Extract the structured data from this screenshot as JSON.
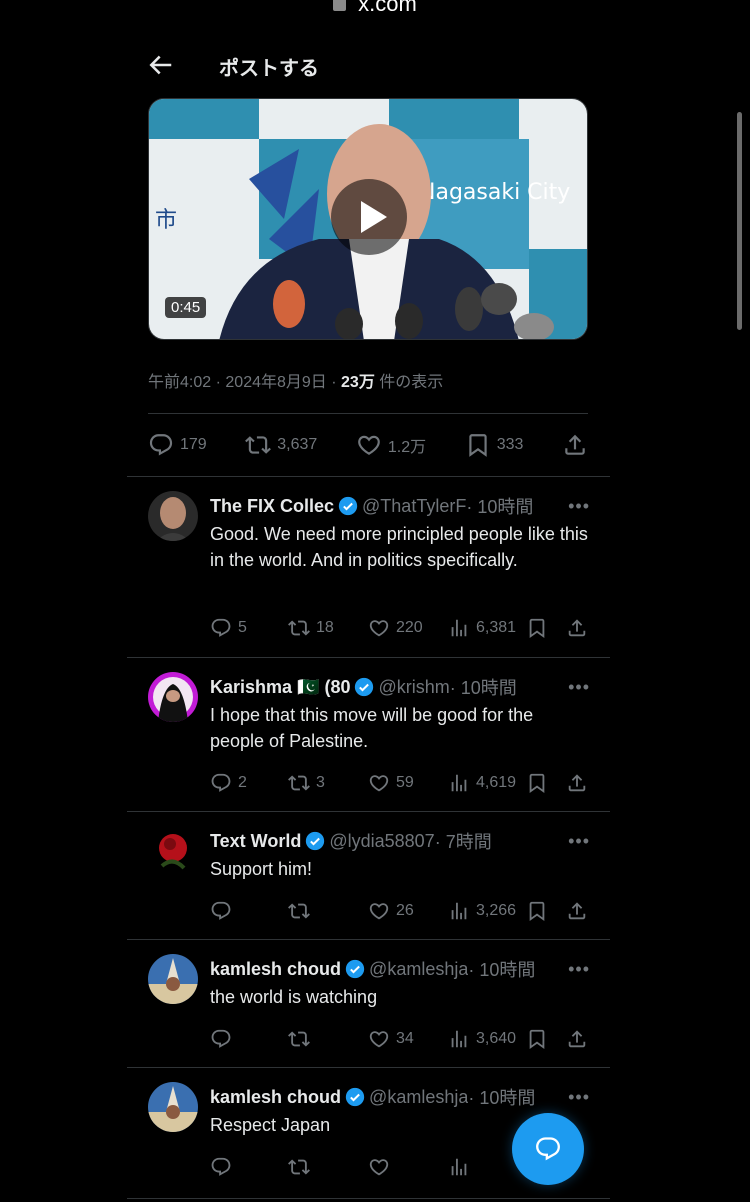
{
  "browser": {
    "url": "x.com"
  },
  "header": {
    "title": "ポストする"
  },
  "video": {
    "duration": "0:45",
    "backdrop_text": "Nagasaki City",
    "backdrop_kanji": "市"
  },
  "post_meta": {
    "time": "午前4:02",
    "sep1": "·",
    "date": "2024年8月9日",
    "sep2": "·",
    "views": "23万",
    "views_label": "件の表示"
  },
  "post_stats": {
    "replies": "179",
    "reposts": "3,637",
    "likes": "1.2万",
    "bookmarks": "333"
  },
  "replies": [
    {
      "name": "The FIX Collec",
      "handle": "@ThatTylerF",
      "time": "· 10時間",
      "text": "Good. We need more principled people like this in the world. And in politics specifically.",
      "replies": "5",
      "reposts": "18",
      "likes": "220",
      "views": "6,381"
    },
    {
      "name": "Karishma 🇵🇰 (80",
      "handle": "@krishm",
      "time": "· 10時間",
      "text": "I hope that this move will be good for the people of Palestine.",
      "replies": "2",
      "reposts": "3",
      "likes": "59",
      "views": "4,619"
    },
    {
      "name": "Text World",
      "handle": "@lydia58807",
      "time": "· 7時間",
      "text": "Support him!",
      "replies": "",
      "reposts": "",
      "likes": "26",
      "views": "3,266"
    },
    {
      "name": "kamlesh choud",
      "handle": "@kamleshja",
      "time": "· 10時間",
      "text": "the world is watching",
      "replies": "",
      "reposts": "",
      "likes": "34",
      "views": "3,640"
    },
    {
      "name": "kamlesh choud",
      "handle": "@kamleshja",
      "time": "· 10時間",
      "text": "Respect Japan",
      "replies": "",
      "reposts": "",
      "likes": "",
      "views": ""
    }
  ],
  "colors": {
    "accent": "#1d9bf0",
    "muted": "#71767b",
    "background": "#000000",
    "divider": "#2f3336"
  }
}
